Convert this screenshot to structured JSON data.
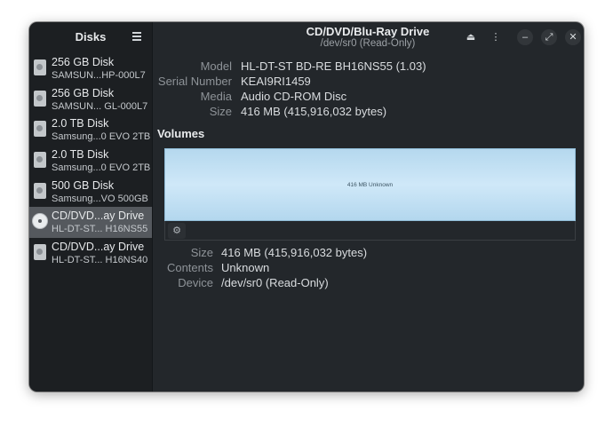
{
  "sidebar": {
    "title": "Disks",
    "menu_icon": "hamburger-icon",
    "items": [
      {
        "name": "256 GB Disk",
        "model": "SAMSUN...HP-000L7",
        "icon": "harddisk-icon"
      },
      {
        "name": "256 GB Disk",
        "model": "SAMSUN... GL-000L7",
        "icon": "harddisk-icon"
      },
      {
        "name": "2.0 TB Disk",
        "model": "Samsung...0 EVO 2TB",
        "icon": "harddisk-icon"
      },
      {
        "name": "2.0 TB Disk",
        "model": "Samsung...0 EVO 2TB",
        "icon": "harddisk-icon"
      },
      {
        "name": "500 GB Disk",
        "model": "Samsung...VO 500GB",
        "icon": "harddisk-icon"
      },
      {
        "name": "CD/DVD...ay Drive",
        "model": "HL-DT-ST... H16NS55",
        "icon": "cd-icon",
        "selected": true
      },
      {
        "name": "CD/DVD...ay Drive",
        "model": "HL-DT-ST... H16NS40",
        "icon": "harddisk-icon"
      }
    ]
  },
  "header": {
    "title": "CD/DVD/Blu-Ray Drive",
    "subtitle": "/dev/sr0 (Read-Only)",
    "eject_glyph": "⏏",
    "menu_glyph": "⋮",
    "minimize_glyph": "–",
    "maximize_glyph": "⤢",
    "close_glyph": "✕"
  },
  "drive": {
    "model_label": "Model",
    "model_value": "HL-DT-ST BD-RE  BH16NS55 (1.03)",
    "serial_label": "Serial Number",
    "serial_value": "KEAI9RI1459",
    "media_label": "Media",
    "media_value": "Audio CD-ROM Disc",
    "size_label": "Size",
    "size_value": "416 MB (415,916,032 bytes)"
  },
  "volumes": {
    "title": "Volumes",
    "bar_label": "416 MB Unknown",
    "bar_color": "#b8dbf2",
    "gear_glyph": "⚙"
  },
  "volume_details": {
    "size_label": "Size",
    "size_value": "416 MB (415,916,032 bytes)",
    "contents_label": "Contents",
    "contents_value": "Unknown",
    "device_label": "Device",
    "device_value": "/dev/sr0 (Read-Only)"
  }
}
